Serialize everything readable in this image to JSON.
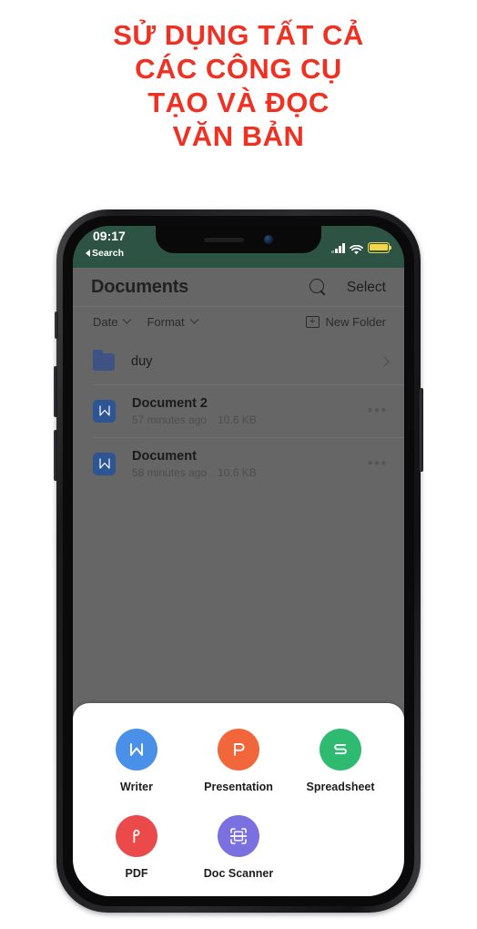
{
  "promo": {
    "color": "#ef3124",
    "lines": [
      "SỬ DỤNG TẤT CẢ",
      "CÁC CÔNG CỤ",
      "TẠO VÀ ĐỌC",
      "VĂN BẢN"
    ]
  },
  "statusbar": {
    "time": "09:17",
    "back_label": "Search",
    "background": "#2c5344",
    "battery_color": "#f3d54a",
    "signal_icon": "cellular-bars-icon",
    "wifi_icon": "wifi-icon",
    "battery_icon": "battery-icon"
  },
  "nav": {
    "title": "Documents",
    "search_icon": "search-icon",
    "select_label": "Select"
  },
  "filterbar": {
    "filters": [
      {
        "label": "Date",
        "icon": "chevron-down-icon"
      },
      {
        "label": "Format",
        "icon": "chevron-down-icon"
      }
    ],
    "new_folder_label": "New Folder",
    "new_folder_icon": "folder-plus-icon"
  },
  "files": [
    {
      "name": "duy",
      "type": "folder",
      "icon": "folder-icon",
      "modified": "",
      "size": "",
      "accessory": "chevron-right-icon"
    },
    {
      "name": "Document 2",
      "type": "document",
      "icon": "writer-doc-icon",
      "modified": "57 minutes ago",
      "size": "10.6 KB",
      "accessory": "more-options-icon"
    },
    {
      "name": "Document",
      "type": "document",
      "icon": "writer-doc-icon",
      "modified": "58 minutes ago",
      "size": "10.6 KB",
      "accessory": "more-options-icon"
    }
  ],
  "sheet": {
    "tools": [
      {
        "label": "Writer",
        "icon": "writer-icon",
        "color": "#4a90e8"
      },
      {
        "label": "Presentation",
        "icon": "presentation-icon",
        "color": "#f2663c"
      },
      {
        "label": "Spreadsheet",
        "icon": "spreadsheet-icon",
        "color": "#2fba72"
      },
      {
        "label": "PDF",
        "icon": "pdf-icon",
        "color": "#ec4a4a"
      },
      {
        "label": "Doc Scanner",
        "icon": "doc-scanner-icon",
        "color": "#7b70e0"
      }
    ]
  }
}
